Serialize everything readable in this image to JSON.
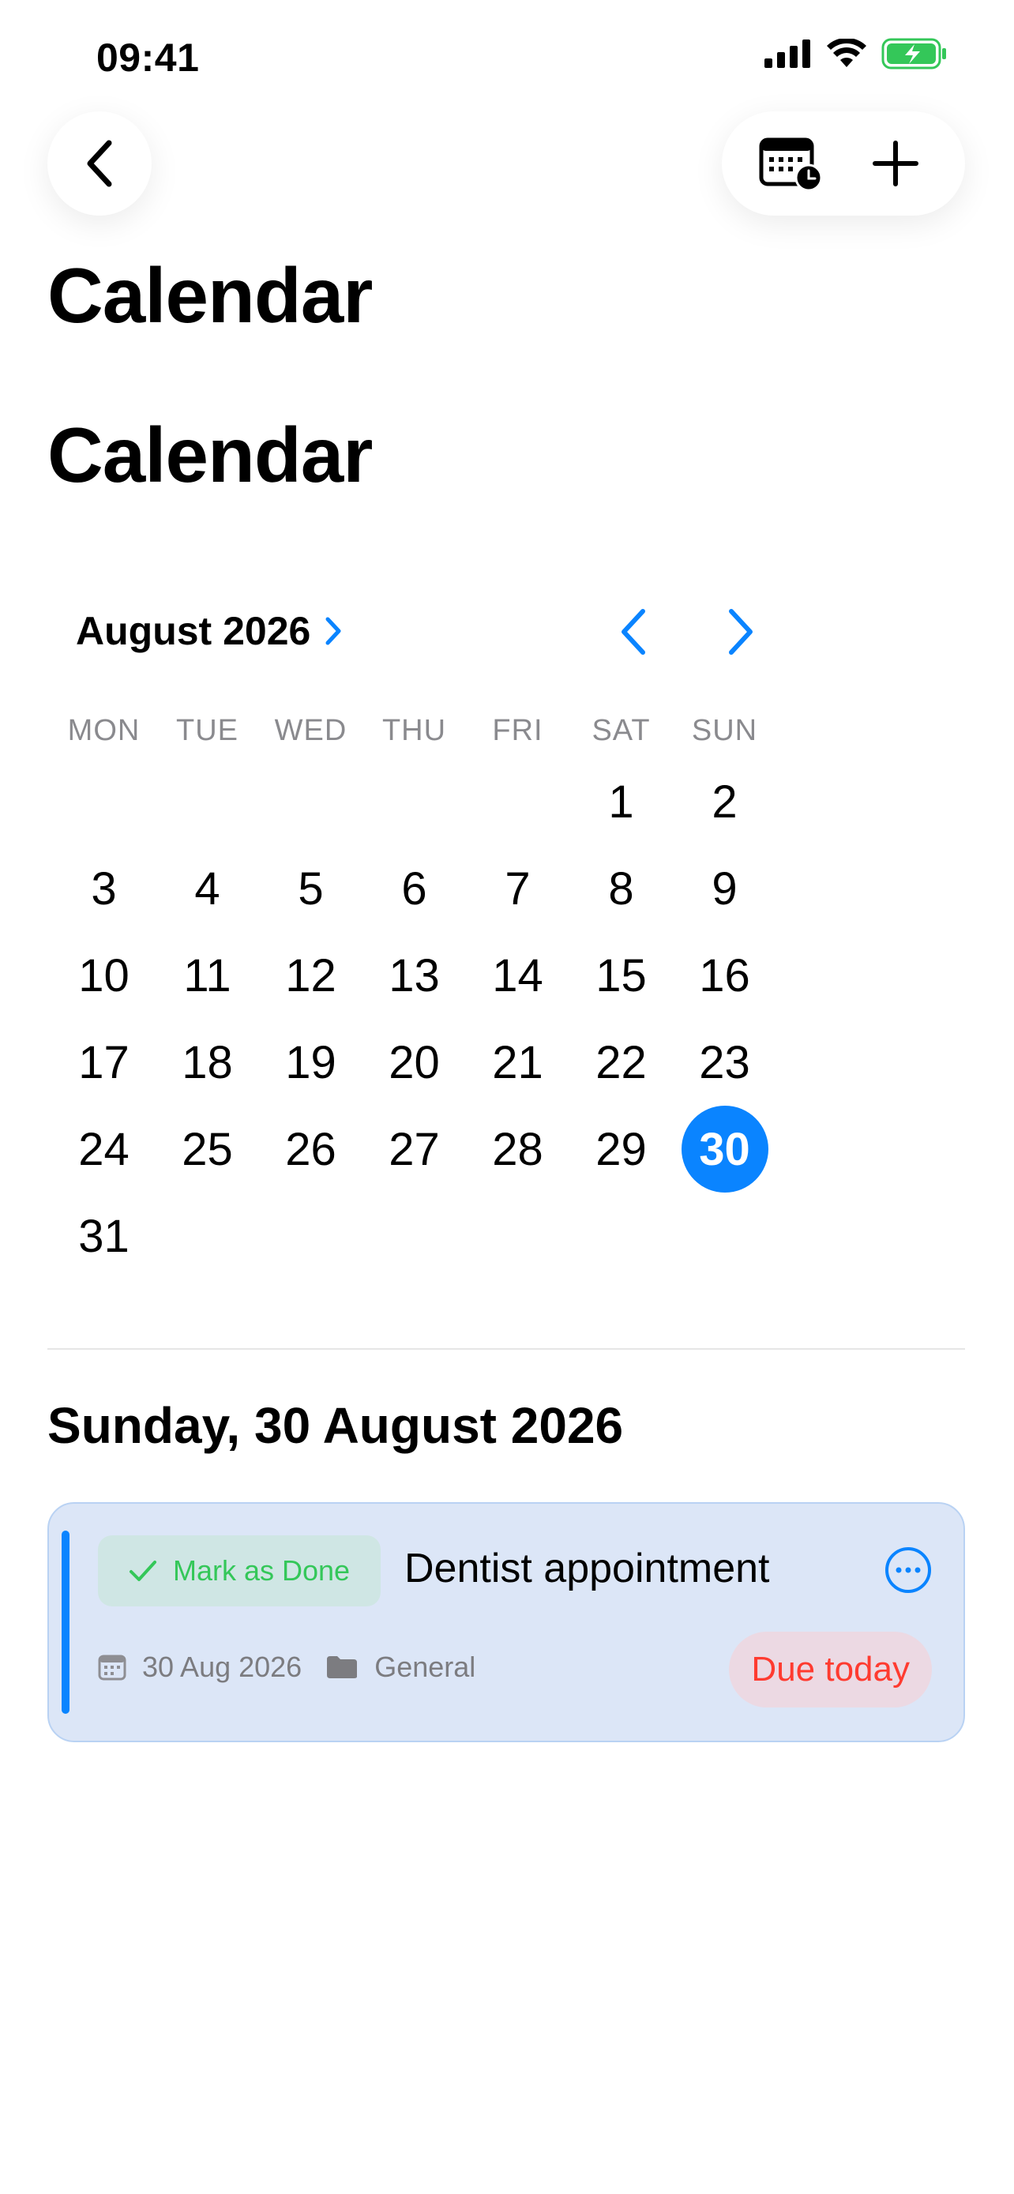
{
  "status_bar": {
    "time": "09:41"
  },
  "titles": {
    "large_title": "Calendar",
    "page_title": "Calendar"
  },
  "calendar": {
    "month_label": "August 2026",
    "weekdays": [
      "MON",
      "TUE",
      "WED",
      "THU",
      "FRI",
      "SAT",
      "SUN"
    ],
    "days": [
      "",
      "",
      "",
      "",
      "",
      "1",
      "2",
      "3",
      "4",
      "5",
      "6",
      "7",
      "8",
      "9",
      "10",
      "11",
      "12",
      "13",
      "14",
      "15",
      "16",
      "17",
      "18",
      "19",
      "20",
      "21",
      "22",
      "23",
      "24",
      "25",
      "26",
      "27",
      "28",
      "29",
      "30",
      "31"
    ],
    "selected_day": "30"
  },
  "agenda": {
    "date_heading": "Sunday, 30 August 2026",
    "task": {
      "mark_done_label": "Mark as Done",
      "title": "Dentist appointment",
      "date": "30 Aug 2026",
      "list": "General",
      "due_label": "Due today"
    }
  },
  "colors": {
    "accent": "#0a84ff",
    "done_green": "#34c759",
    "due_red": "#ff3b30",
    "card_bg": "#dce6f7"
  },
  "icons": {
    "back": "chevron-left-icon",
    "calendar_clock": "calendar-clock-icon",
    "add": "plus-icon",
    "more": "ellipsis-circle-icon",
    "checkmark": "checkmark-icon",
    "date": "calendar-small-icon",
    "list": "folder-icon"
  }
}
